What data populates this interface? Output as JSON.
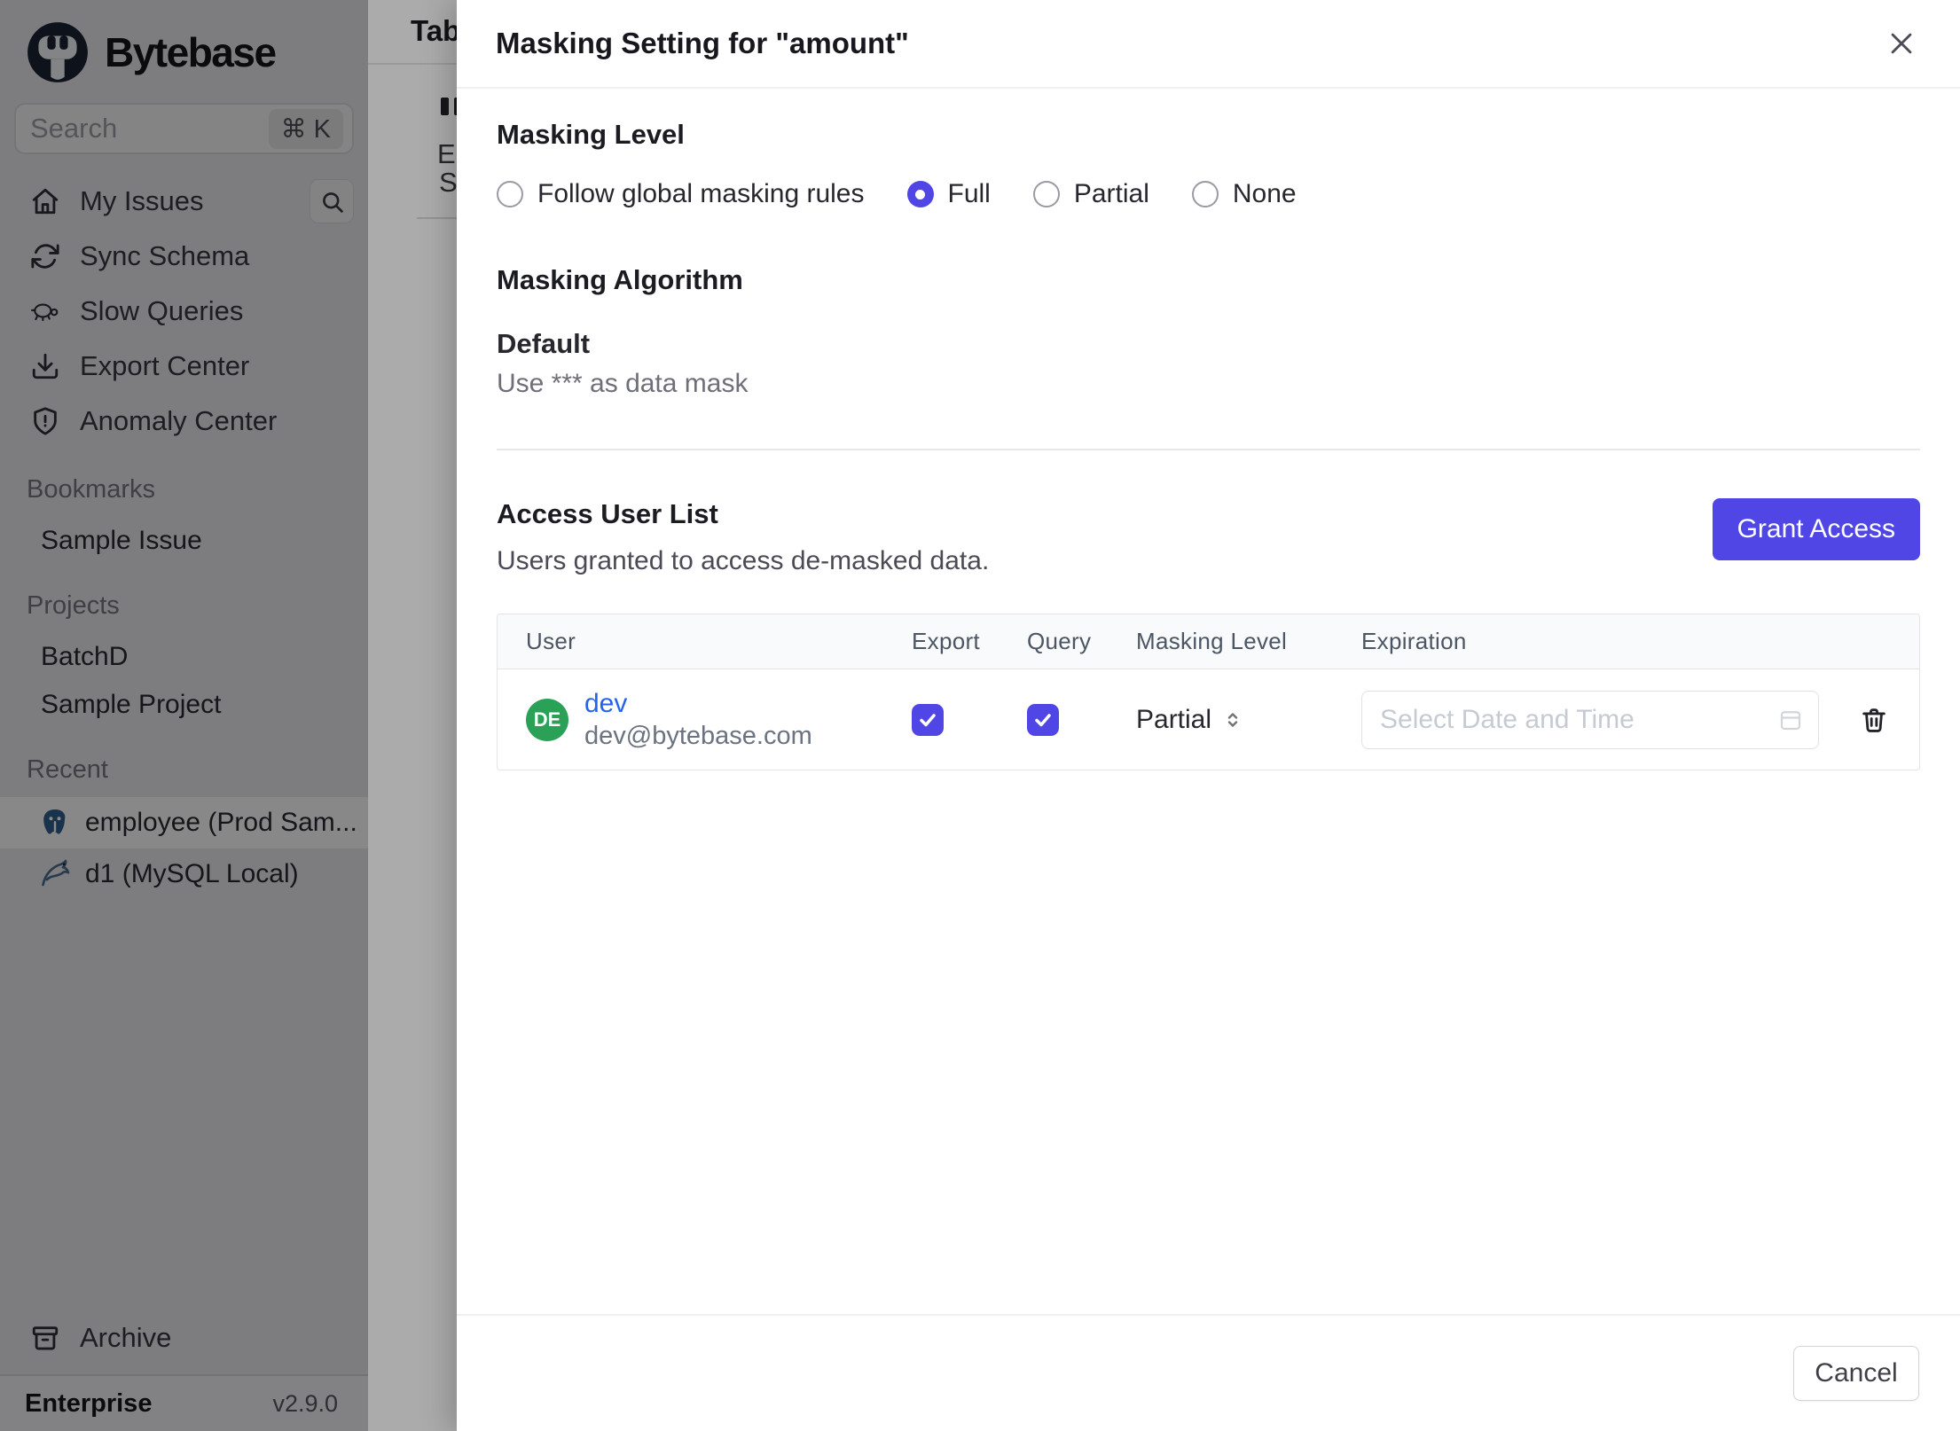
{
  "sidebar": {
    "logo_text": "Bytebase",
    "search": {
      "placeholder": "Search",
      "shortcut": "⌘ K"
    },
    "nav": [
      {
        "label": "My Issues",
        "icon": "home-icon"
      },
      {
        "label": "Sync Schema",
        "icon": "sync-icon"
      },
      {
        "label": "Slow Queries",
        "icon": "turtle-icon"
      },
      {
        "label": "Export Center",
        "icon": "download-icon"
      },
      {
        "label": "Anomaly Center",
        "icon": "shield-icon"
      }
    ],
    "sections": [
      {
        "title": "Bookmarks",
        "items": [
          {
            "label": "Sample Issue"
          }
        ]
      },
      {
        "title": "Projects",
        "items": [
          {
            "label": "BatchD"
          },
          {
            "label": "Sample Project"
          }
        ]
      },
      {
        "title": "Recent",
        "items": [
          {
            "label": "employee (Prod Sam...",
            "icon": "postgresql-icon",
            "active": true
          },
          {
            "label": "d1 (MySQL Local)",
            "icon": "mysql-icon",
            "active": false
          }
        ]
      }
    ],
    "archive_label": "Archive",
    "footer": {
      "plan": "Enterprise",
      "version": "v2.9.0"
    }
  },
  "underlay": {
    "title_fragment": "Tab",
    "fragments": [
      "E",
      "S"
    ]
  },
  "drawer": {
    "title": "Masking Setting for \"amount\"",
    "masking_level": {
      "heading": "Masking Level",
      "options": [
        {
          "label": "Follow global masking rules",
          "selected": false
        },
        {
          "label": "Full",
          "selected": true
        },
        {
          "label": "Partial",
          "selected": false
        },
        {
          "label": "None",
          "selected": false
        }
      ]
    },
    "masking_algorithm": {
      "heading": "Masking Algorithm",
      "name": "Default",
      "description": "Use *** as data mask"
    },
    "access_user_list": {
      "heading": "Access User List",
      "subtitle": "Users granted to access de-masked data.",
      "grant_button": "Grant Access",
      "table": {
        "headers": [
          "User",
          "Export",
          "Query",
          "Masking Level",
          "Expiration"
        ],
        "rows": [
          {
            "user_name": "dev",
            "user_email": "dev@bytebase.com",
            "avatar_initials": "DE",
            "export_checked": true,
            "query_checked": true,
            "masking_level": "Partial",
            "expiration_placeholder": "Select Date and Time"
          }
        ]
      }
    },
    "footer": {
      "cancel_label": "Cancel"
    }
  },
  "colors": {
    "accent": "#4f46e5",
    "link": "#2563eb",
    "avatar_green": "#2ba158"
  }
}
